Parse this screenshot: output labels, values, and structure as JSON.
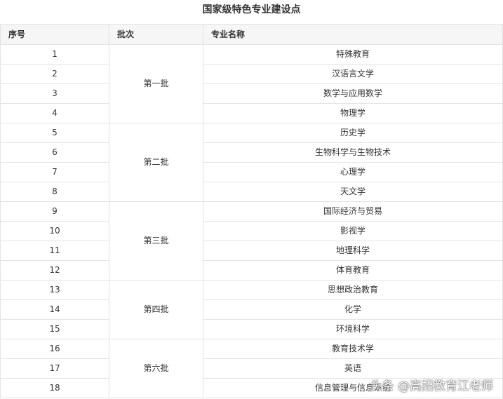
{
  "title": "国家级特色专业建设点",
  "headers": {
    "index": "序号",
    "batch": "批次",
    "major": "专业名称"
  },
  "groups": [
    {
      "batch": "第一批",
      "rows": [
        {
          "no": "1",
          "major": "特殊教育"
        },
        {
          "no": "2",
          "major": "汉语言文学"
        },
        {
          "no": "3",
          "major": "数学与应用数学"
        },
        {
          "no": "4",
          "major": "物理学"
        }
      ]
    },
    {
      "batch": "第二批",
      "rows": [
        {
          "no": "5",
          "major": "历史学"
        },
        {
          "no": "6",
          "major": "生物科学与生物技术"
        },
        {
          "no": "7",
          "major": "心理学"
        },
        {
          "no": "8",
          "major": "天文学"
        }
      ]
    },
    {
      "batch": "第三批",
      "rows": [
        {
          "no": "9",
          "major": "国际经济与贸易"
        },
        {
          "no": "10",
          "major": "影视学"
        },
        {
          "no": "11",
          "major": "地理科学"
        },
        {
          "no": "12",
          "major": "体育教育"
        }
      ]
    },
    {
      "batch": "第四批",
      "rows": [
        {
          "no": "13",
          "major": "思想政治教育"
        },
        {
          "no": "14",
          "major": "化学"
        },
        {
          "no": "15",
          "major": "环境科学"
        }
      ]
    },
    {
      "batch": "第六批",
      "rows": [
        {
          "no": "16",
          "major": "教育技术学"
        },
        {
          "no": "17",
          "major": "英语"
        },
        {
          "no": "18",
          "major": "信息管理与信息系统"
        }
      ]
    }
  ],
  "watermark": "头条 @高招教育江老师"
}
